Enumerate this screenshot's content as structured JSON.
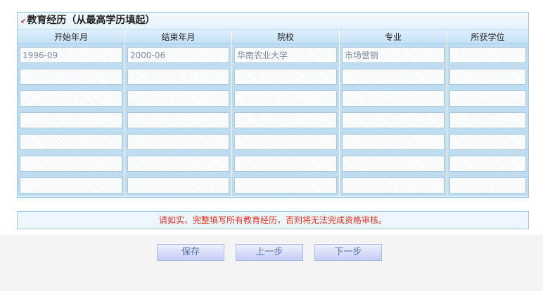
{
  "section": {
    "title": "教育经历（从最高学历填起）"
  },
  "table": {
    "headers": [
      "开始年月",
      "结束年月",
      "院校",
      "专业",
      "所获学位"
    ],
    "rows": [
      [
        "1996-09",
        "2000-06",
        "华南农业大学",
        "市场营销",
        ""
      ],
      [
        "",
        "",
        "",
        "",
        ""
      ],
      [
        "",
        "",
        "",
        "",
        ""
      ],
      [
        "",
        "",
        "",
        "",
        ""
      ],
      [
        "",
        "",
        "",
        "",
        ""
      ],
      [
        "",
        "",
        "",
        "",
        ""
      ],
      [
        "",
        "",
        "",
        "",
        ""
      ]
    ]
  },
  "notice": "请如实、完整填写所有教育经历，否则将无法完成资格审核。",
  "buttons": {
    "save": "保存",
    "prev": "上一步",
    "next": "下一步"
  },
  "colors": {
    "accent_border": "#9cc8e6",
    "notice_text": "#e03020",
    "button_text": "#5a6ea8"
  }
}
